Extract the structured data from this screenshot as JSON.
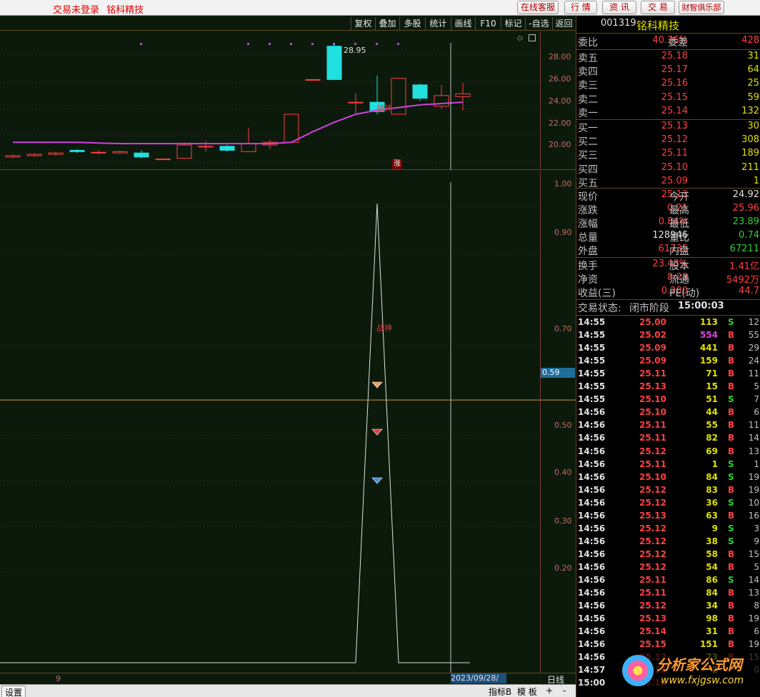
{
  "topbar": {
    "status": "交易未登录",
    "stock_name": "铭科精技",
    "buttons": [
      "在线客服",
      "行 情",
      "资 讯",
      "交 易",
      "财智俱乐部"
    ]
  },
  "chart_tools": [
    "复权",
    "叠加",
    "多股",
    "统计",
    "画线",
    "F10",
    "标记",
    "-自选",
    "返回"
  ],
  "price_chart": {
    "y_ticks": [
      "28.00",
      "26.00",
      "24.00",
      "22.00",
      "20.00"
    ],
    "high_label": "28.95",
    "indicator_label": "战神",
    "limit_up_marker": "涨"
  },
  "indicator_chart": {
    "y_ticks": [
      "1.00",
      "0.90",
      "0.70",
      "0.50",
      "0.40",
      "0.30",
      "0.20"
    ],
    "label": "战神",
    "current_value": "0.59"
  },
  "bottom": {
    "cursor_date": "2023/09/28/四",
    "period": "日线",
    "left_marker": "9",
    "settings": "设置",
    "tabs": [
      "指标B",
      "模 板",
      "+",
      "-"
    ]
  },
  "quote": {
    "code": "001319",
    "name": "铭科精技",
    "weibi_label": "委比",
    "weibi": "40.76%",
    "weicha_label": "委差",
    "weicha": "428",
    "sell": [
      {
        "label": "卖五",
        "price": "25.18",
        "vol": "31"
      },
      {
        "label": "卖四",
        "price": "25.17",
        "vol": "64"
      },
      {
        "label": "卖三",
        "price": "25.16",
        "vol": "25"
      },
      {
        "label": "卖二",
        "price": "25.15",
        "vol": "59"
      },
      {
        "label": "卖一",
        "price": "25.14",
        "vol": "132"
      }
    ],
    "buy": [
      {
        "label": "买一",
        "price": "25.13",
        "vol": "30"
      },
      {
        "label": "买二",
        "price": "25.12",
        "vol": "308"
      },
      {
        "label": "买三",
        "price": "25.11",
        "vol": "189"
      },
      {
        "label": "买四",
        "price": "25.10",
        "vol": "211"
      },
      {
        "label": "买五",
        "price": "25.09",
        "vol": "1"
      }
    ],
    "stats1": [
      {
        "l1": "现价",
        "v1": "25.13",
        "l2": "今开",
        "v2": "24.92",
        "c1": "red",
        "c2": "wht"
      },
      {
        "l1": "涨跌",
        "v1": "0.21",
        "l2": "最高",
        "v2": "25.96",
        "c1": "red",
        "c2": "red"
      },
      {
        "l1": "涨幅",
        "v1": "0.84%",
        "l2": "最低",
        "v2": "23.89",
        "c1": "red",
        "c2": "grn"
      },
      {
        "l1": "总量",
        "v1": "128946",
        "l2": "量比",
        "v2": "0.74",
        "c1": "wht",
        "c2": "grn"
      },
      {
        "l1": "外盘",
        "v1": "61735",
        "l2": "内盘",
        "v2": "67211",
        "c1": "red",
        "c2": "grn"
      }
    ],
    "stats2": [
      {
        "l1": "换手",
        "v1": "23.48%",
        "l2": "股本",
        "v2": "1.41亿"
      },
      {
        "l1": "净资",
        "v1": "8.28",
        "l2": "流通",
        "v2": "5492万"
      },
      {
        "l1": "收益(三)",
        "v1": "0.280",
        "l2": "PE(动)",
        "v2": "44.7"
      }
    ],
    "trade_status_label": "交易状态:",
    "trade_status": "闭市阶段",
    "trade_time": "15:00:03",
    "ticks": [
      {
        "t": "14:55",
        "p": "25.00",
        "v": "113",
        "s": "S",
        "n": "12"
      },
      {
        "t": "14:55",
        "p": "25.02",
        "v": "554",
        "s": "B",
        "n": "55"
      },
      {
        "t": "14:55",
        "p": "25.09",
        "v": "441",
        "s": "B",
        "n": "29"
      },
      {
        "t": "14:55",
        "p": "25.09",
        "v": "159",
        "s": "B",
        "n": "24"
      },
      {
        "t": "14:55",
        "p": "25.11",
        "v": "71",
        "s": "B",
        "n": "11"
      },
      {
        "t": "14:55",
        "p": "25.13",
        "v": "15",
        "s": "B",
        "n": "5"
      },
      {
        "t": "14:55",
        "p": "25.10",
        "v": "51",
        "s": "S",
        "n": "7"
      },
      {
        "t": "14:56",
        "p": "25.10",
        "v": "44",
        "s": "B",
        "n": "6"
      },
      {
        "t": "14:56",
        "p": "25.11",
        "v": "55",
        "s": "B",
        "n": "11"
      },
      {
        "t": "14:56",
        "p": "25.11",
        "v": "82",
        "s": "B",
        "n": "14"
      },
      {
        "t": "14:56",
        "p": "25.12",
        "v": "69",
        "s": "B",
        "n": "13"
      },
      {
        "t": "14:56",
        "p": "25.11",
        "v": "1",
        "s": "S",
        "n": "1"
      },
      {
        "t": "14:56",
        "p": "25.10",
        "v": "84",
        "s": "S",
        "n": "19"
      },
      {
        "t": "14:56",
        "p": "25.12",
        "v": "83",
        "s": "B",
        "n": "19"
      },
      {
        "t": "14:56",
        "p": "25.12",
        "v": "36",
        "s": "S",
        "n": "10"
      },
      {
        "t": "14:56",
        "p": "25.13",
        "v": "63",
        "s": "B",
        "n": "16"
      },
      {
        "t": "14:56",
        "p": "25.12",
        "v": "9",
        "s": "S",
        "n": "3"
      },
      {
        "t": "14:56",
        "p": "25.12",
        "v": "38",
        "s": "S",
        "n": "9"
      },
      {
        "t": "14:56",
        "p": "25.12",
        "v": "58",
        "s": "B",
        "n": "15"
      },
      {
        "t": "14:56",
        "p": "25.12",
        "v": "54",
        "s": "B",
        "n": "5"
      },
      {
        "t": "14:56",
        "p": "25.11",
        "v": "86",
        "s": "S",
        "n": "14"
      },
      {
        "t": "14:56",
        "p": "25.11",
        "v": "84",
        "s": "B",
        "n": "13"
      },
      {
        "t": "14:56",
        "p": "25.12",
        "v": "34",
        "s": "B",
        "n": "8"
      },
      {
        "t": "14:56",
        "p": "25.13",
        "v": "98",
        "s": "B",
        "n": "19"
      },
      {
        "t": "14:56",
        "p": "25.14",
        "v": "31",
        "s": "B",
        "n": "6"
      },
      {
        "t": "14:56",
        "p": "25.15",
        "v": "151",
        "s": "B",
        "n": "19"
      },
      {
        "t": "14:56",
        "p": "25.17",
        "v": "73",
        "s": "B",
        "n": "15"
      },
      {
        "t": "14:57",
        "p": "25.13",
        "v": "2",
        "s": "",
        "n": "0"
      },
      {
        "t": "15:00",
        "p": "25.13",
        "v": "",
        "s": "",
        "n": ""
      }
    ],
    "watermark": "分析家公式网",
    "watermark_url": "www.fxjgsw.com"
  },
  "chart_data": {
    "type": "candlestick",
    "series_price": {
      "candles": [
        {
          "o": 20.4,
          "c": 20.5,
          "h": 20.6,
          "l": 20.3
        },
        {
          "o": 20.5,
          "c": 20.6,
          "h": 20.7,
          "l": 20.4
        },
        {
          "o": 20.6,
          "c": 20.7,
          "h": 20.8,
          "l": 20.5
        },
        {
          "o": 20.9,
          "c": 20.8,
          "h": 21.0,
          "l": 20.7
        },
        {
          "o": 20.7,
          "c": 20.75,
          "h": 20.9,
          "l": 20.6
        },
        {
          "o": 20.7,
          "c": 20.8,
          "h": 20.9,
          "l": 20.6
        },
        {
          "o": 20.7,
          "c": 20.4,
          "h": 20.9,
          "l": 20.3
        },
        {
          "o": 20.2,
          "c": 20.25,
          "h": 20.3,
          "l": 20.2
        },
        {
          "o": 20.3,
          "c": 21.3,
          "h": 21.5,
          "l": 20.3
        },
        {
          "o": 21.2,
          "c": 21.2,
          "h": 21.6,
          "l": 20.8
        },
        {
          "o": 21.2,
          "c": 20.9,
          "h": 21.3,
          "l": 20.8
        },
        {
          "o": 20.8,
          "c": 21.4,
          "h": 22.6,
          "l": 20.8
        },
        {
          "o": 21.3,
          "c": 21.5,
          "h": 21.7,
          "l": 21.0
        },
        {
          "o": 21.5,
          "c": 23.6,
          "h": 23.6,
          "l": 21.4
        },
        {
          "o": 26.2,
          "c": 26.2,
          "h": 26.2,
          "l": 26.2
        },
        {
          "o": 28.7,
          "c": 26.2,
          "h": 28.95,
          "l": 26.2
        },
        {
          "o": 24.5,
          "c": 24.5,
          "h": 25.2,
          "l": 23.6
        },
        {
          "o": 24.5,
          "c": 23.8,
          "h": 26.5,
          "l": 23.6
        },
        {
          "o": 23.6,
          "c": 26.3,
          "h": 26.3,
          "l": 23.6
        },
        {
          "o": 25.8,
          "c": 24.8,
          "h": 25.9,
          "l": 24.6
        },
        {
          "o": 24.2,
          "c": 25.0,
          "h": 25.8,
          "l": 24.0
        },
        {
          "o": 24.92,
          "c": 25.13,
          "h": 25.96,
          "l": 23.89
        }
      ],
      "ma": [
        21.5,
        21.5,
        21.5,
        21.5,
        21.45,
        21.4,
        21.4,
        21.4,
        21.4,
        21.4,
        21.4,
        21.4,
        21.4,
        21.5,
        22.3,
        23.0,
        23.6,
        23.9,
        24.1,
        24.3,
        24.4,
        24.5
      ],
      "ylim": [
        19.0,
        30.0
      ]
    },
    "series_indicator": {
      "values": [
        0,
        0,
        0,
        0,
        0,
        0,
        0,
        0,
        0,
        0,
        0,
        0,
        0,
        0,
        0,
        0,
        0,
        1.0,
        0,
        0,
        0,
        0
      ],
      "ylim": [
        0,
        1.05
      ]
    }
  }
}
